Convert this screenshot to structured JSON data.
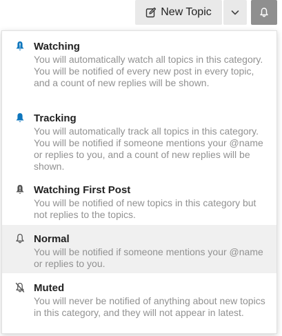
{
  "toolbar": {
    "new_topic_label": "New Topic",
    "icons": {
      "new_topic": "pencil-square-icon",
      "dropdown": "chevron-down-icon",
      "notifications": "bell-icon"
    }
  },
  "notification_menu": {
    "options": [
      {
        "title": "Watching",
        "description": "You will automatically watch all topics in this category. You will be notified of every new post in every topic, and a count of new replies will be shown.",
        "icon": "bell-exclamation-icon",
        "icon_color": "#0e76bd"
      },
      {
        "title": "Tracking",
        "description": "You will automatically track all topics in this category. You will be notified if someone mentions your @name or replies to you, and a count of new replies will be shown.",
        "icon": "bell-icon",
        "icon_color": "#0e76bd"
      },
      {
        "title": "Watching First Post",
        "description": "You will be notified of new topics in this category but not replies to the topics.",
        "icon": "bell-exclamation-icon",
        "icon_color": "#555555"
      },
      {
        "title": "Normal",
        "description": "You will be notified if someone mentions your @name or replies to you.",
        "icon": "bell-outline-icon",
        "icon_color": "#555555",
        "selected": true
      },
      {
        "title": "Muted",
        "description": "You will never be notified of anything about new topics in this category, and they will not appear in latest.",
        "icon": "bell-slash-icon",
        "icon_color": "#555555"
      }
    ]
  },
  "colors": {
    "button_bg": "#e9e9e9",
    "active_button_bg": "#8f8f8f",
    "title_text": "#222222",
    "description_text": "#919191",
    "selected_bg": "#f0f0f0"
  }
}
